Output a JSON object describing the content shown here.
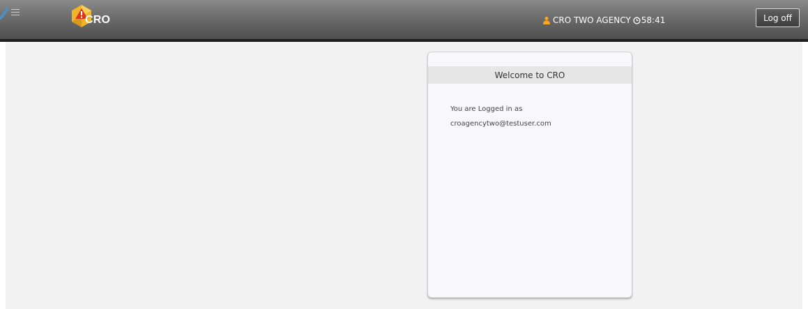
{
  "header": {
    "logo_text": "CRO",
    "user_name": "CRO TWO AGENCY",
    "session_timer": "58:41",
    "logoff_label": "Log off"
  },
  "welcome_card": {
    "title": "Welcome to CRO",
    "logged_in_text": "You are Logged in as",
    "user_email": "croagencytwo@testuser.com"
  },
  "icons": {
    "menu": "hamburger-menu-icon",
    "logo": "cro-logo-icon",
    "user": "user-icon",
    "clock": "clock-icon"
  },
  "colors": {
    "topbar": "#6c6c6c",
    "content_bg": "#f2f2f2",
    "card_bg": "#f8f8fc",
    "card_header_bg": "#e6e6e6",
    "logo_gold": "#f0b429",
    "logo_red": "#d9381e",
    "user_icon": "#f5a623",
    "corner_accent": "#4a90c8"
  }
}
